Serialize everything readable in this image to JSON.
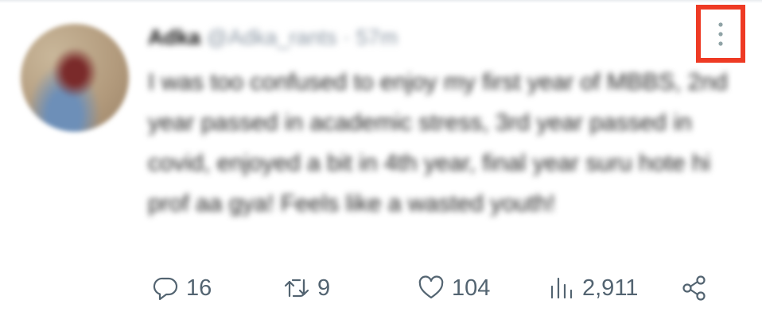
{
  "tweet": {
    "author_name": "Adka",
    "author_handle": "@Adka_rants",
    "separator": "·",
    "timestamp": "57m",
    "text": "I was too confused to enjoy my first year of MBBS, 2nd year passed in academic stress, 3rd year passed in covid, enjoyed a bit in 4th year, final year suru hote hi prof aa gya! Feels like a wasted youth!"
  },
  "actions": {
    "reply_count": "16",
    "retweet_count": "9",
    "like_count": "104",
    "views_count": "2,911"
  },
  "icons": {
    "more": "more-vertical-icon",
    "reply": "reply-icon",
    "retweet": "retweet-icon",
    "like": "heart-icon",
    "views": "views-icon",
    "share": "share-icon"
  },
  "colors": {
    "highlight_box": "#ee3a24",
    "action_gray": "#536471",
    "handle_gray": "#8a96a3"
  }
}
